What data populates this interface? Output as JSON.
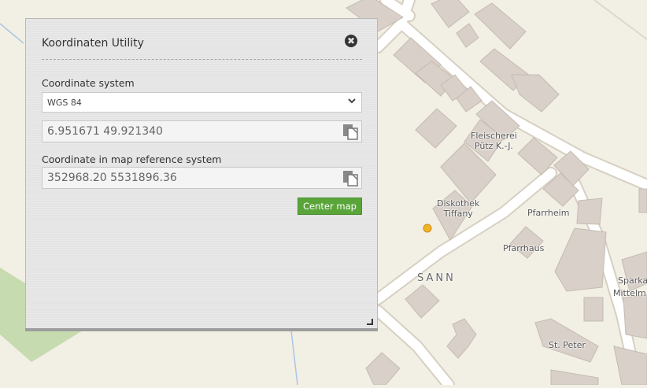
{
  "map": {
    "labels": {
      "fleischerei": "Fleischerei\nPütz K.-J.",
      "diskothek": "Diskothek\nTiffany",
      "pfarrheim": "Pfarrheim",
      "pfarrhaus": "Pfarrhaus",
      "sann": "SANN",
      "st_peter": "St. Peter",
      "sparka": "Sparka",
      "mittelm": "Mittelm"
    },
    "colors": {
      "background": "#f2efe4",
      "building": "#d9d0c9",
      "road": "#ffffff",
      "green": "#c7dbb0",
      "water": "#a9c7e8",
      "poi": "#f0b429"
    }
  },
  "panel": {
    "title": "Koordinaten Utility",
    "close_icon": "close-circle-icon",
    "coordinate_system_label": "Coordinate system",
    "coordinate_system_value": "WGS 84",
    "coordinate_value": "6.951671 49.921340",
    "map_ref_label": "Coordinate in map reference system",
    "map_ref_value": "352968.20 5531896.36",
    "center_button": "Center map",
    "colors": {
      "button": "#5aa53a",
      "panel": "#e4e4e4"
    }
  }
}
